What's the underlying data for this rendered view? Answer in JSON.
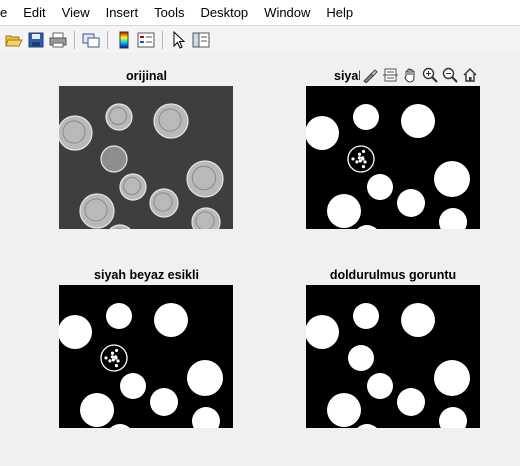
{
  "menu": [
    "e",
    "Edit",
    "View",
    "Insert",
    "Tools",
    "Desktop",
    "Window",
    "Help"
  ],
  "toolbar_icons": [
    "open-file-icon",
    "save-icon",
    "print-icon",
    "link-plot-icon",
    "colorbar-icon",
    "legend-icon",
    "pointer-icon",
    "property-editor-icon"
  ],
  "axes": [
    {
      "title": "orijinal",
      "kind": "original"
    },
    {
      "title": "siyal",
      "kind": "bw"
    },
    {
      "title": "siyah beyaz esikli",
      "kind": "bw"
    },
    {
      "title": "doldurulmus goruntu",
      "kind": "filled"
    }
  ],
  "axes_toolbar_icons": [
    "brush-icon",
    "data-cursor-icon",
    "pan-icon",
    "zoom-in-icon",
    "zoom-out-icon",
    "home-icon"
  ]
}
